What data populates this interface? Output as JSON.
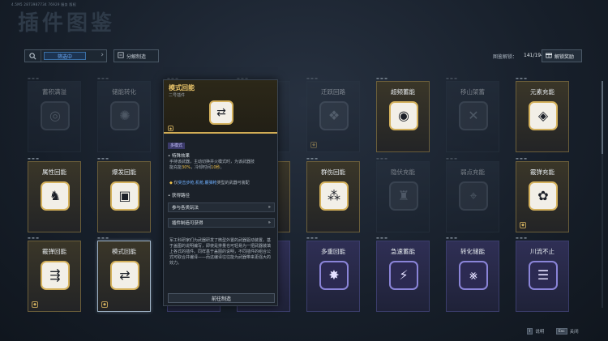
{
  "version_text": "4.5M5 2873987734 76929 服务 版权",
  "title": "插件图鉴",
  "toolbar": {
    "filter_label": "筛选中",
    "dismantle_label": "分解制造",
    "progress_label": "图鉴解锁：",
    "progress_value": "141/194",
    "unlock_reward_label": "解锁奖励"
  },
  "cards": [
    {
      "name": "蓄积满溢",
      "tier": "plain",
      "dim": true,
      "icon": "swirl-icon",
      "glyph": "◎"
    },
    {
      "name": "储能转化",
      "tier": "plain",
      "dim": true,
      "icon": "sun-icon",
      "glyph": "✺"
    },
    {
      "name": "",
      "tier": "plain",
      "dim": true,
      "icon": "blank-icon",
      "glyph": ""
    },
    {
      "name": "",
      "tier": "plain",
      "dim": true,
      "icon": "blank-icon",
      "glyph": ""
    },
    {
      "name": "迁跃回路",
      "tier": "plain",
      "dim": true,
      "icon": "cube-icon",
      "glyph": "❖",
      "corner": true
    },
    {
      "name": "超频蓄能",
      "tier": "gold",
      "dim": false,
      "icon": "eye-icon",
      "glyph": "◉"
    },
    {
      "name": "移山架蓄",
      "tier": "plain",
      "dim": true,
      "icon": "axe-icon",
      "glyph": "✕"
    },
    {
      "name": "元素充能",
      "tier": "gold",
      "dim": false,
      "icon": "diamond-icon",
      "glyph": "◈"
    },
    {
      "name": "属性回能",
      "tier": "gold",
      "dim": false,
      "icon": "dragon-icon",
      "glyph": "♞"
    },
    {
      "name": "爆发回能",
      "tier": "gold",
      "dim": false,
      "icon": "frame-icon",
      "glyph": "▣"
    },
    {
      "name": "",
      "tier": "gold",
      "dim": false,
      "icon": "blank-icon",
      "glyph": ""
    },
    {
      "name": "",
      "tier": "gold",
      "dim": false,
      "icon": "blank-icon",
      "glyph": ""
    },
    {
      "name": "群伤回能",
      "tier": "gold",
      "dim": false,
      "icon": "nodes-icon",
      "glyph": "⁂"
    },
    {
      "name": "隐伏充能",
      "tier": "plain",
      "dim": true,
      "icon": "cloak-icon",
      "glyph": "♜"
    },
    {
      "name": "弱点充能",
      "tier": "plain",
      "dim": true,
      "icon": "target-icon",
      "glyph": "⌖"
    },
    {
      "name": "霰弹充能",
      "tier": "gold",
      "dim": false,
      "icon": "spiral-icon",
      "glyph": "✿",
      "corner": true
    },
    {
      "name": "霰弹回能",
      "tier": "gold",
      "dim": false,
      "icon": "arrows-icon",
      "glyph": "⇶",
      "corner": true
    },
    {
      "name": "模式回能",
      "tier": "gold",
      "dim": false,
      "icon": "shuffle-icon",
      "glyph": "⇄",
      "corner": true,
      "selected": true
    },
    {
      "name": "",
      "tier": "purple",
      "dim": false,
      "icon": "blank-icon",
      "glyph": ""
    },
    {
      "name": "",
      "tier": "purple",
      "dim": false,
      "icon": "blank-icon",
      "glyph": ""
    },
    {
      "name": "多重回能",
      "tier": "purple",
      "dim": false,
      "icon": "burst-icon",
      "glyph": "✸"
    },
    {
      "name": "急速蓄能",
      "tier": "purple",
      "dim": false,
      "icon": "bolt-icon",
      "glyph": "⚡"
    },
    {
      "name": "转化储能",
      "tier": "purple",
      "dim": false,
      "icon": "rune-icon",
      "glyph": "⨳"
    },
    {
      "name": "川流不止",
      "tier": "purple",
      "dim": false,
      "icon": "stack-icon",
      "glyph": "☰"
    }
  ],
  "popup": {
    "title": "模式回能",
    "subtitle": "二号插件",
    "mode_tag": "多模式",
    "effect_heading": "• 特殊效果",
    "effect_line1": "手持该武器，主动切换并火模式时，为该武器技",
    "effect_pre": "能充能",
    "effect_pct": "30%",
    "effect_mid": "，冷却时间",
    "effect_time": "10秒",
    "effect_end": "。",
    "weapon_pre": "仅",
    "weapon_types": "突击步枪,机枪,霰弹枪",
    "weapon_post": "类型的武器可装配",
    "acquire_heading": "• 获得路径",
    "route1": "参与各类玩法",
    "route2": "插件制造可获得",
    "lore": "军工科研家们为武器研发了微型外置的武器驱动装置。基于盖图的说明编写，即使是排量也可轻易为一把武器装填上各式的插件。同样基于盖图的说明，不同插件的组合公式可取合并编译——而这编译往往能为武器带来更强大的效力。",
    "goto_label": "前往制造"
  },
  "footer": {
    "help_key": "I",
    "help_label": "说明",
    "close_key": "Esc",
    "close_label": "关闭"
  }
}
